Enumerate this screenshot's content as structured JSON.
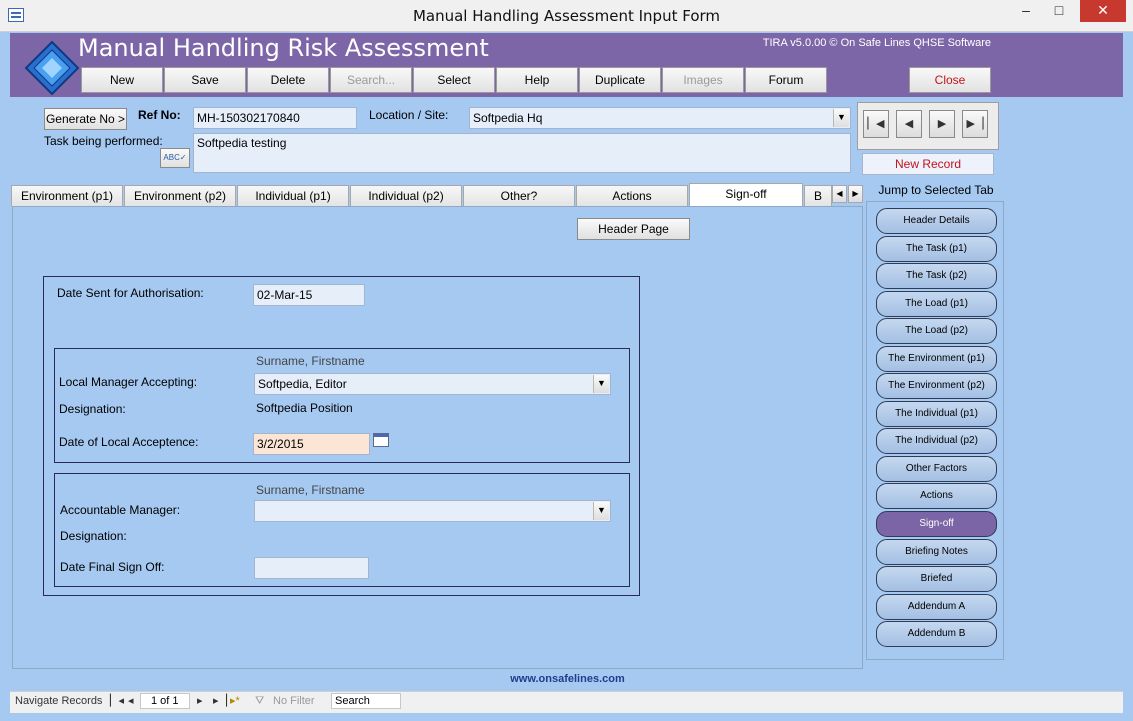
{
  "window": {
    "title": "Manual Handling Assessment Input Form",
    "min": "–",
    "max": "□",
    "close": "✕"
  },
  "header": {
    "app_title": "Manual Handling Risk Assessment",
    "version": "TIRA v5.0.00 © On Safe Lines QHSE Software",
    "brand_color": "#7d66a8"
  },
  "toolbar": {
    "new": "New",
    "save": "Save",
    "delete": "Delete",
    "search": "Search...",
    "select": "Select",
    "help": "Help",
    "duplicate": "Duplicate",
    "images": "Images",
    "forum": "Forum",
    "close": "Close"
  },
  "record": {
    "generate_label": "Generate No >",
    "ref_label": "Ref No:",
    "ref_value": "MH-150302170840",
    "location_label": "Location / Site:",
    "location_value": "Softpedia Hq",
    "task_label": "Task being performed:",
    "task_value": "Softpedia testing",
    "spell_icon": "abc-check-icon"
  },
  "navigation": {
    "first": "▏◀",
    "prev": "◀",
    "next": "▶",
    "last": "▶▕",
    "new_record": "New Record"
  },
  "tabs": [
    {
      "label": "Environment (p1)"
    },
    {
      "label": "Environment (p2)"
    },
    {
      "label": "Individual (p1)"
    },
    {
      "label": "Individual (p2)"
    },
    {
      "label": "Other?"
    },
    {
      "label": "Actions"
    },
    {
      "label": "Sign-off"
    },
    {
      "label": "B"
    }
  ],
  "signoff": {
    "header_page": "Header Page",
    "date_sent_label": "Date Sent for Authorisation:",
    "date_sent_value": "02-Mar-15",
    "name_hint": "Surname, Firstname",
    "local_manager_label": "Local Manager Accepting:",
    "local_manager_value": "Softpedia, Editor",
    "designation_label": "Designation:",
    "designation_value": "Softpedia Position",
    "local_accept_label": "Date of Local Acceptence:",
    "local_accept_value": "3/2/2015",
    "name_hint2": "Surname, Firstname",
    "accountable_label": "Accountable Manager:",
    "accountable_value": "",
    "designation2_label": "Designation:",
    "final_signoff_label": "Date Final Sign Off:",
    "final_signoff_value": ""
  },
  "jump": {
    "title": "Jump to Selected Tab",
    "items": [
      "Header Details",
      "The Task (p1)",
      "The Task (p2)",
      "The Load (p1)",
      "The Load (p2)",
      "The Environment (p1)",
      "The Environment (p2)",
      "The Individual (p1)",
      "The Individual (p2)",
      "Other Factors",
      "Actions",
      "Sign-off",
      "Briefing Notes",
      "Briefed",
      "Addendum A",
      "Addendum B"
    ]
  },
  "footer": {
    "url": "www.onsafelines.com"
  },
  "status": {
    "navigate_label": "Navigate Records",
    "first": "▏◂",
    "prev": "◂",
    "record_counter": "1 of 1",
    "next": "▸",
    "last": "▸▕",
    "new": "▸*",
    "filter": "No Filter",
    "search": "Search"
  }
}
